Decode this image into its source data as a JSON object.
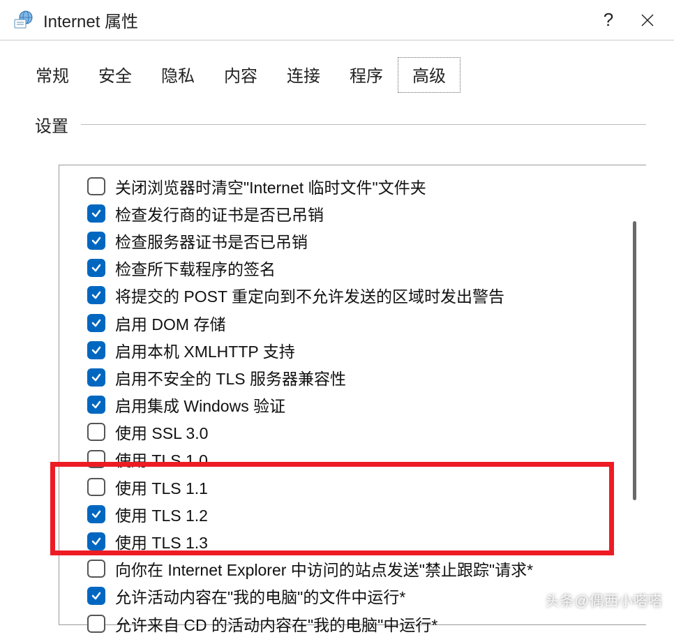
{
  "window": {
    "title": "Internet 属性",
    "help_label": "?",
    "close_label": "✕"
  },
  "tabs": [
    {
      "label": "常规"
    },
    {
      "label": "安全"
    },
    {
      "label": "隐私"
    },
    {
      "label": "内容"
    },
    {
      "label": "连接"
    },
    {
      "label": "程序"
    },
    {
      "label": "高级",
      "active": true
    }
  ],
  "section": {
    "title": "设置"
  },
  "items": [
    {
      "checked": false,
      "label": "关闭浏览器时清空\"Internet 临时文件\"文件夹"
    },
    {
      "checked": true,
      "label": "检查发行商的证书是否已吊销"
    },
    {
      "checked": true,
      "label": "检查服务器证书是否已吊销"
    },
    {
      "checked": true,
      "label": "检查所下载程序的签名"
    },
    {
      "checked": true,
      "label": "将提交的 POST 重定向到不允许发送的区域时发出警告"
    },
    {
      "checked": true,
      "label": "启用 DOM 存储"
    },
    {
      "checked": true,
      "label": "启用本机 XMLHTTP 支持"
    },
    {
      "checked": true,
      "label": "启用不安全的 TLS 服务器兼容性"
    },
    {
      "checked": true,
      "label": "启用集成 Windows 验证"
    },
    {
      "checked": false,
      "label": "使用 SSL 3.0"
    },
    {
      "checked": false,
      "label": "使用 TLS 1.0"
    },
    {
      "checked": false,
      "label": "使用 TLS 1.1"
    },
    {
      "checked": true,
      "label": "使用 TLS 1.2"
    },
    {
      "checked": true,
      "label": "使用 TLS 1.3"
    },
    {
      "checked": false,
      "label": "向你在 Internet Explorer 中访问的站点发送\"禁止跟踪\"请求*"
    },
    {
      "checked": true,
      "label": "允许活动内容在\"我的电脑\"的文件中运行*"
    },
    {
      "checked": false,
      "label": "允许来自 CD 的活动内容在\"我的电脑\"中运行*"
    }
  ],
  "watermark": "头条@偶西小嗒嗒"
}
